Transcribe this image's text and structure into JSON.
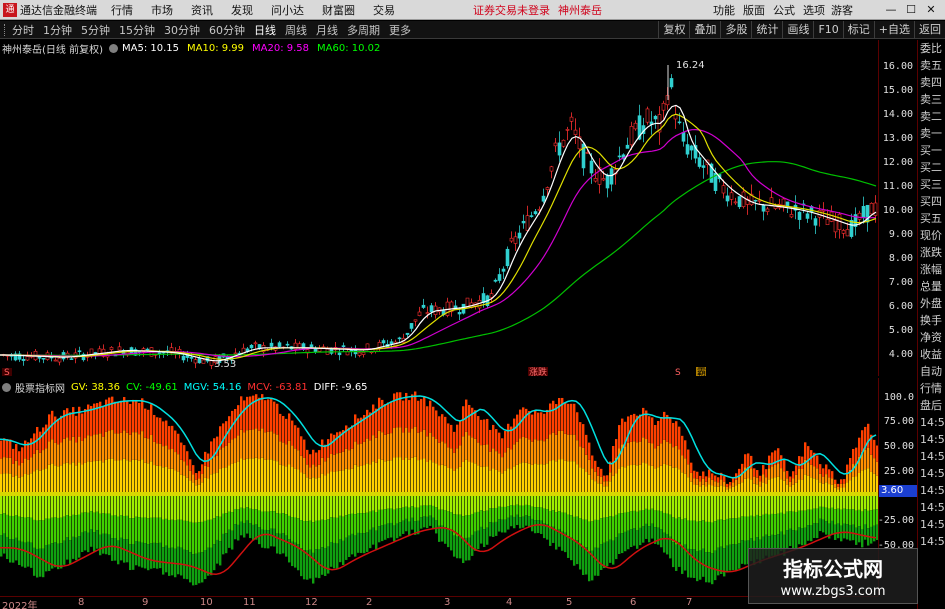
{
  "menubar": {
    "app_title": "通达信金融终端",
    "menus": [
      "行情",
      "市场",
      "资讯",
      "发现",
      "问小达",
      "财富圈",
      "交易"
    ],
    "notice": "证券交易未登录",
    "stock_name": "神州泰岳",
    "right_items": [
      "功能",
      "版面",
      "公式",
      "选项"
    ],
    "guest": "游客"
  },
  "periodbar": {
    "periods": [
      "分时",
      "1分钟",
      "5分钟",
      "15分钟",
      "30分钟",
      "60分钟",
      "日线",
      "周线",
      "月线",
      "多周期",
      "更多"
    ],
    "active": "日线",
    "tools": [
      "复权",
      "叠加",
      "多股",
      "统计",
      "画线",
      "F10",
      "标记",
      "+自选",
      "返回"
    ]
  },
  "main_legend": {
    "title": "神州泰岳(日线 前复权)",
    "ma": [
      {
        "label": "MA5: 10.15",
        "color": "#ffffff"
      },
      {
        "label": "MA10: 9.99",
        "color": "#ffff00"
      },
      {
        "label": "MA20: 9.58",
        "color": "#ff00ff"
      },
      {
        "label": "MA60: 10.02",
        "color": "#00ff00"
      }
    ]
  },
  "price_axis": [
    "16.00",
    "15.00",
    "14.00",
    "13.00",
    "12.00",
    "11.00",
    "10.00",
    "9.00",
    "8.00",
    "7.00",
    "6.00",
    "5.00",
    "4.00"
  ],
  "price_annotations": {
    "high": "16.24",
    "low": "3.53"
  },
  "event_markers": [
    "S",
    "涨跌",
    "S",
    "霸"
  ],
  "side_panel": [
    "委比",
    "卖五",
    "卖四",
    "卖三",
    "卖二",
    "卖一",
    "买一",
    "买二",
    "买三",
    "买四",
    "买五",
    "现价",
    "涨跌",
    "涨幅",
    "总量",
    "外盘",
    "换手",
    "净资",
    "收益",
    "自动",
    "行情",
    "盘后",
    "14:50",
    "14:50",
    "14:50",
    "14:50",
    "14:50",
    "14:50",
    "14:50",
    "14:50"
  ],
  "ind_legend": {
    "name": "股票指标网",
    "items": [
      {
        "label": "GV: 38.36",
        "color": "#ffff00"
      },
      {
        "label": "CV: -49.61",
        "color": "#00ff00"
      },
      {
        "label": "MGV: 54.16",
        "color": "#00ffff"
      },
      {
        "label": "MCV: -63.81",
        "color": "#ff3030"
      },
      {
        "label": "DIFF: -9.65",
        "color": "#ffffff"
      }
    ]
  },
  "ind_axis": [
    "100.0",
    "75.00",
    "50.00",
    "25.00",
    "-25.00",
    "-50.00"
  ],
  "ind_current": "3.60",
  "date_axis": [
    "2022年",
    "8",
    "9",
    "10",
    "11",
    "12",
    "2",
    "3",
    "4",
    "5",
    "6",
    "7"
  ],
  "watermark": {
    "line1": "指标公式网",
    "line2": "www.zbgs3.com"
  },
  "colors": {
    "up": "#ff3030",
    "ma5": "#ffffff",
    "ma10": "#ffff00",
    "ma20": "#ff00ff",
    "ma60": "#00ff00",
    "mgv": "#00ffff",
    "mcv": "#e02020"
  }
}
